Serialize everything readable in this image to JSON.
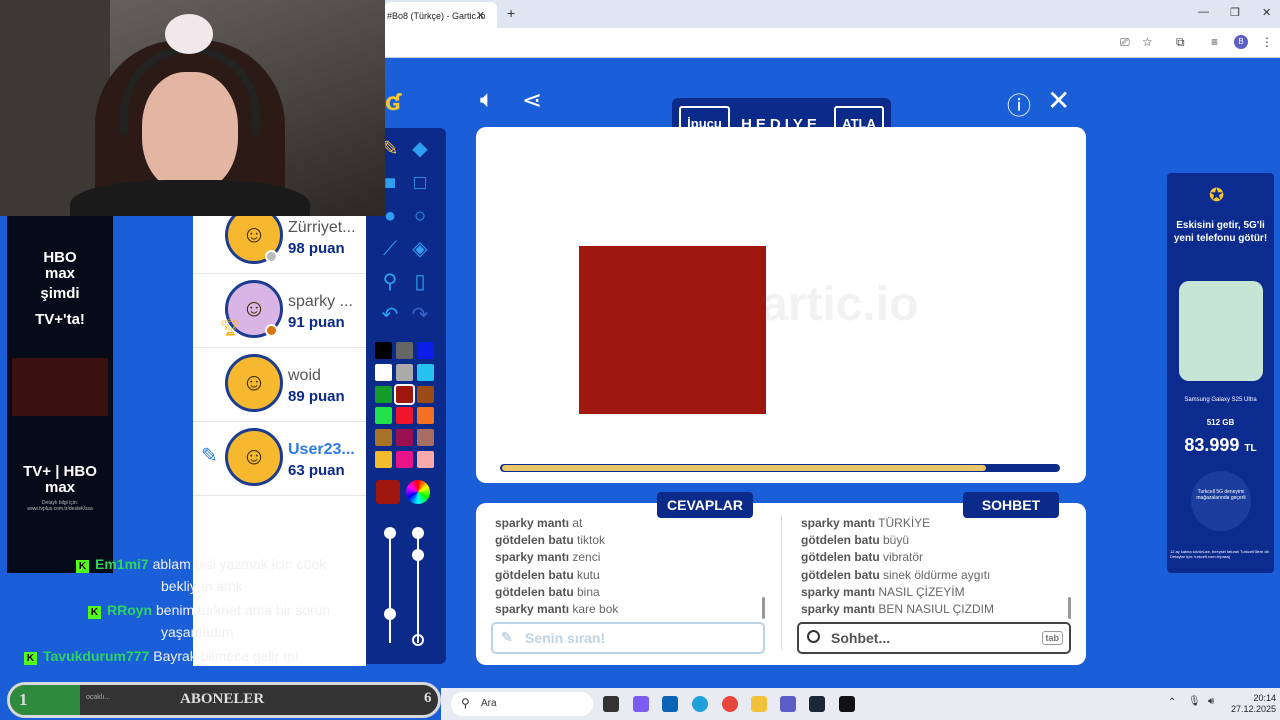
{
  "browser": {
    "tab_title": "#Bo8 (Türkçe) - Gartic.io",
    "close_glyph": "✕",
    "new_tab_glyph": "+",
    "profile_initial": "B"
  },
  "game": {
    "hint_label": "İpucu",
    "secret_word": "HEDIYE",
    "skip_label": "ATLA",
    "watermark": "artic.io",
    "timer_progress": 0.87,
    "brush_color": "#a0170f",
    "answers_tab": "CEVAPLAR",
    "chat_tab": "SOHBET",
    "answer_placeholder": "Senin sıran!",
    "chat_placeholder": "Sohbet...",
    "tab_key": "tab"
  },
  "answers": [
    {
      "user": "sparky mantı",
      "text": "at"
    },
    {
      "user": "götdelen batu",
      "text": "tiktok"
    },
    {
      "user": "sparky mantı",
      "text": "zenci"
    },
    {
      "user": "götdelen batu",
      "text": "kutu"
    },
    {
      "user": "götdelen batu",
      "text": "bina"
    },
    {
      "user": "sparky mantı",
      "text": "kare bok"
    }
  ],
  "chat": [
    {
      "user": "sparky mantı",
      "text": "TÜRKİYE"
    },
    {
      "user": "götdelen batu",
      "text": "büyü"
    },
    {
      "user": "götdelen batu",
      "text": "vibratör"
    },
    {
      "user": "götdelen batu",
      "text": "sinek öldürme aygıtı"
    },
    {
      "user": "sparky mantı",
      "text": "NASIL ÇİZEYİM"
    },
    {
      "user": "sparky mantı",
      "text": "BEN NASIUL ÇIZDIM"
    }
  ],
  "players": [
    {
      "name": "Zürriyet...",
      "score": "98 puan"
    },
    {
      "name": "sparky ...",
      "score": "91 puan"
    },
    {
      "name": "woid",
      "score": "89 puan"
    },
    {
      "name": "User23...",
      "score": "63 puan"
    }
  ],
  "palette": [
    "#000000",
    "#666666",
    "#0a1ee8",
    "#ffffff",
    "#aaaaaa",
    "#27c2f0",
    "#149c2b",
    "#a0170f",
    "#9c4a16",
    "#22e04a",
    "#f0142d",
    "#f07222",
    "#a87327",
    "#9a0f4f",
    "#a86e64",
    "#f2bd2c",
    "#e9138a",
    "#f9a9a9"
  ],
  "ads": {
    "left_line1": "HBO",
    "left_line2": "max",
    "left_line3": "şimdi",
    "left_line4": "TV+'ta!",
    "left_bottom": "TV+ | HBO max",
    "left_small": "Detaylı bilgi için: www.tvplus.com.tr/destek/ssa",
    "right_headline": "Eskisini getir, 5G'li yeni telefonu götür!",
    "right_model": "Samsung Galaxy S25 Ultra",
    "right_storage": "512 GB",
    "right_price": "83.999",
    "right_currency": "TL",
    "right_badge": "Turkcell 5G deneyimi mağazalarında geçerli",
    "right_terms": "12 ay kalma sözünüze, bireysel faturalı Turkcell'lilere dir. Detaylar için: turkcell.com.tr/pasaj"
  },
  "stream_chat": [
    {
      "user": "Em1mi7",
      "text": "ablam bisi yazmak icin c0ok",
      "cont": "bekliyon amk"
    },
    {
      "user": "RRoyn",
      "text": "benim turknet ama bir sorun",
      "cont": "yaşamadım"
    },
    {
      "user": "Tavukdurum777",
      "text": "Bayrak bilmece gelir mi",
      "cont": ""
    }
  ],
  "subs": {
    "left_num": "1",
    "label": "ABONELER",
    "right_num": "6",
    "overlay": "ocaklı..."
  },
  "taskbar": {
    "search": "Ara",
    "time": "20:14",
    "date": "27.12.2025"
  }
}
